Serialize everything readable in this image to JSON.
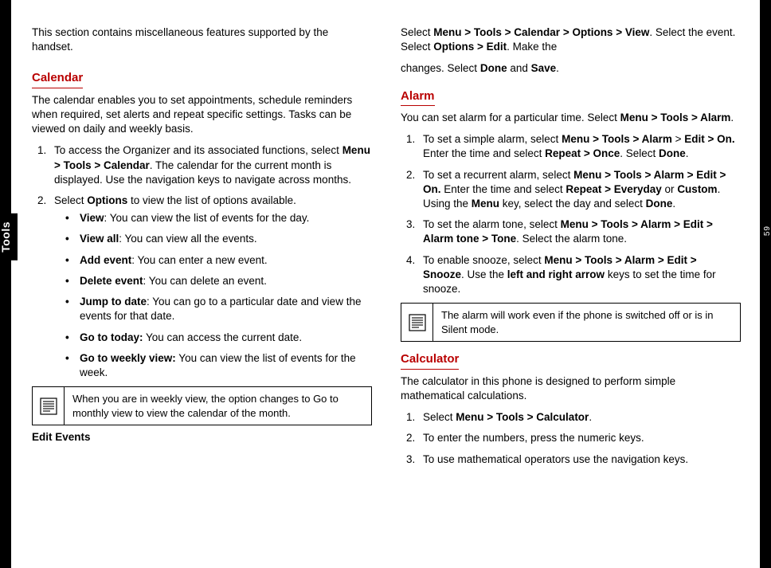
{
  "sideTab": "Tools",
  "pageNumber": "59",
  "left": {
    "intro": "This section contains miscellaneous features supported by the handset.",
    "calendar": {
      "heading": "Calendar",
      "desc": "The calendar enables you to set appointments, schedule reminders when required, set alerts and repeat specific settings. Tasks can be viewed on daily and weekly basis.",
      "step1_a": "To access the Organizer and its associated functions, select ",
      "step1_b": "Menu > Tools > Calendar",
      "step1_c": ". The calendar for the current month is displayed. Use the navigation keys to navigate across months.",
      "step2_a": "Select ",
      "step2_b": "Options",
      "step2_c": " to view the list of options available.",
      "opts": {
        "view_l": "View",
        "view_d": ": You can view the list of events for the day.",
        "viewall_l": "View all",
        "viewall_d": ": You can view all the events.",
        "add_l": "Add event",
        "add_d": ": You can enter a new event.",
        "del_l": "Delete event",
        "del_d": ": You can delete an event.",
        "jump_l": "Jump to date",
        "jump_d": ": You can go to a particular date and view the events for that date.",
        "today_l": "Go to today:",
        "today_d": " You can access the current date.",
        "week_l": "Go to weekly view:",
        "week_d": " You can view the list of events for the week."
      },
      "note": "When you are in weekly view, the option changes to Go to monthly view to view the calendar of the month.",
      "editHd": "Edit Events",
      "edit_a": "Select ",
      "edit_b": "Menu > Tools > Calendar > Options > View",
      "edit_c": ". Select the event. Select ",
      "edit_d": "Options > Edit",
      "edit_e": ". Make the "
    }
  },
  "right": {
    "cont_a": "changes. Select ",
    "cont_b": "Done",
    "cont_c": " and ",
    "cont_d": "Save",
    "cont_e": ".",
    "alarm": {
      "heading": "Alarm",
      "desc_a": "You can set alarm for a particular time. Select ",
      "desc_b": "Menu > Tools > Alarm",
      "desc_c": ".",
      "s1_a": "To set a simple alarm, select ",
      "s1_b": "Menu > Tools > Alarm",
      "s1_c": " > ",
      "s1_d": "Edit > On.",
      "s1_e": "  Enter the time and select ",
      "s1_f": "Repeat > Once",
      "s1_g": ". Select ",
      "s1_h": "Done",
      "s1_i": ".",
      "s2_a": "To set a recurrent alarm, select ",
      "s2_b": "Menu > Tools > Alarm > Edit > On.",
      "s2_c": " Enter the time and select ",
      "s2_d": "Repeat > Everyday",
      "s2_e": " or ",
      "s2_f": "Custom",
      "s2_g": ". Using the ",
      "s2_h": "Menu",
      "s2_i": " key, select the day and select ",
      "s2_j": "Done",
      "s2_k": ".",
      "s3_a": "To set the alarm tone, select ",
      "s3_b": "Menu > Tools > Alarm > Edit > Alarm tone > Tone",
      "s3_c": ". Select the alarm tone.",
      "s4_a": "To enable snooze, select ",
      "s4_b": "Menu > Tools > Alarm > Edit > Snooze",
      "s4_c": ". Use the ",
      "s4_d": "left and right arrow",
      "s4_e": " keys to set the time for snooze.",
      "note": "The alarm will work even if the phone is switched off or is in Silent mode."
    },
    "calc": {
      "heading": "Calculator",
      "desc": "The calculator in this phone is designed to perform simple mathematical calculations.",
      "s1_a": "Select ",
      "s1_b": "Menu > Tools > Calculator",
      "s1_c": ".",
      "s2": "To enter the numbers, press the numeric keys.",
      "s3": "To use mathematical operators use the navigation keys."
    }
  }
}
